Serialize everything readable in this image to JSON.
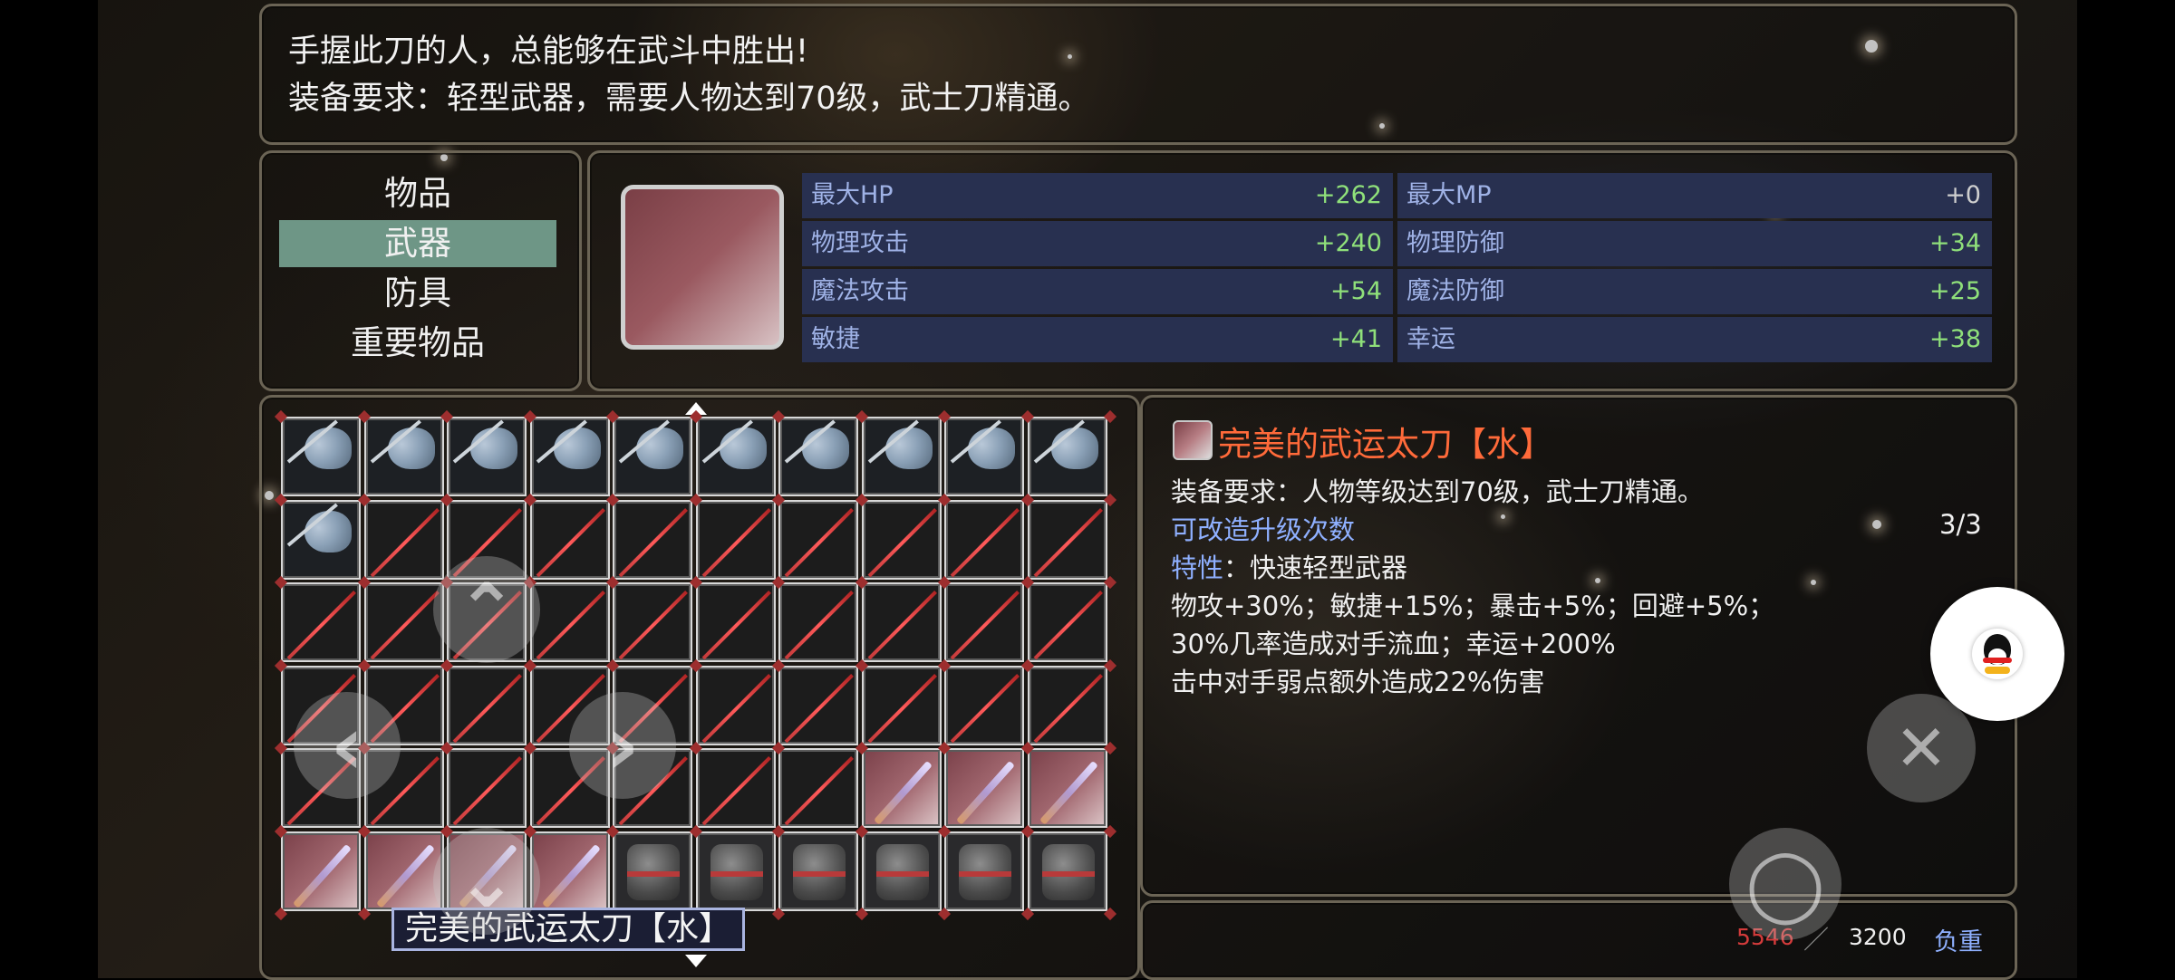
{
  "description": {
    "line1": "手握此刀的人，总能够在武斗中胜出!",
    "line2": "装备要求：轻型武器，需要人物达到70级，武士刀精通。"
  },
  "categories": [
    {
      "label": "物品",
      "selected": false
    },
    {
      "label": "武器",
      "selected": true
    },
    {
      "label": "防具",
      "selected": false
    },
    {
      "label": "重要物品",
      "selected": false
    }
  ],
  "stats": [
    {
      "label": "最大HP",
      "value": "+262"
    },
    {
      "label": "最大MP",
      "value": "+0"
    },
    {
      "label": "物理攻击",
      "value": "+240"
    },
    {
      "label": "物理防御",
      "value": "+34"
    },
    {
      "label": "魔法攻击",
      "value": "+54"
    },
    {
      "label": "魔法防御",
      "value": "+25"
    },
    {
      "label": "敏捷",
      "value": "+41"
    },
    {
      "label": "幸运",
      "value": "+38"
    }
  ],
  "inventory": {
    "rows": [
      [
        "axe",
        "axe",
        "axe",
        "axe",
        "axe",
        "axe",
        "axe",
        "axe",
        "axe",
        "axe"
      ],
      [
        "axe",
        "sword",
        "sword",
        "sword",
        "sword",
        "sword",
        "sword",
        "sword",
        "sword",
        "sword"
      ],
      [
        "sword",
        "sword",
        "sword",
        "sword",
        "sword",
        "sword",
        "sword",
        "sword",
        "sword",
        "sword"
      ],
      [
        "sword",
        "sword",
        "sword",
        "sword",
        "sword",
        "sword",
        "sword",
        "sword",
        "sword",
        "sword"
      ],
      [
        "sword",
        "sword",
        "sword",
        "sword",
        "sword",
        "sword",
        "sword",
        "katana",
        "katana",
        "katana"
      ],
      [
        "katana",
        "katana",
        "katana",
        "katana",
        "armor",
        "armor",
        "armor",
        "armor",
        "armor",
        "armor"
      ]
    ],
    "selected_name": "完美的武运太刀【水】"
  },
  "detail": {
    "title": "完美的武运太刀【水】",
    "requirement": "装备要求：人物等级达到70级，武士刀精通。",
    "upgrade_label": "可改造升级次数",
    "upgrade_count": "3/3",
    "trait_label": "特性",
    "trait_sep": "：",
    "trait_value": "快速轻型武器",
    "effects1": "物攻+30%；敏捷+15%；暴击+5%；回避+5%；",
    "effects2": "30%几率造成对手流血；幸运+200%",
    "effects3": "击中对手弱点额外造成22%伤害"
  },
  "weight": {
    "current": "5546",
    "separator": "／",
    "max": "3200",
    "label": "负重"
  },
  "virtual_controls": {
    "up": "⌃",
    "left": "‹",
    "right": "›",
    "down": "⌄",
    "close": "✕",
    "confirm": "◯"
  },
  "colors": {
    "selected_category": "#6e9686",
    "stat_bg": "#283050",
    "stat_label": "#9fb2e6",
    "stat_value_positive": "#8fe07a",
    "item_title": "#ff6a3a",
    "weight_over": "#d43b3b"
  },
  "icons": {
    "item_icon": "katana-icon",
    "qq": "qq-penguin-icon"
  }
}
